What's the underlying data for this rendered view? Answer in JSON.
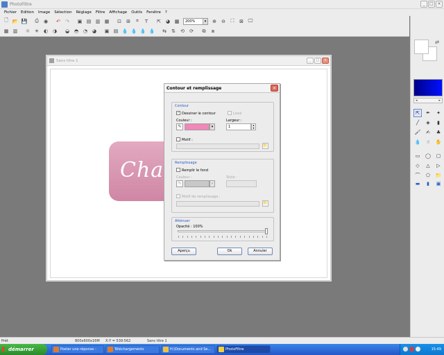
{
  "app": {
    "title": "PhotoFiltre"
  },
  "menu": [
    "Fichier",
    "Edition",
    "Image",
    "Sélection",
    "Réglage",
    "Filtre",
    "Affichage",
    "Outils",
    "Fenêtre",
    "?"
  ],
  "toolbar": {
    "zoom_value": "200%"
  },
  "document": {
    "title": "Sans titre 1",
    "canvas_text": "Charle"
  },
  "dialog": {
    "title": "Contour et remplissage",
    "contour": {
      "group_title": "Contour",
      "draw_contour_label": "Dessiner le contour",
      "draw_contour_checked": true,
      "smooth_label": "Lissé",
      "color_label": "Couleur :",
      "color_value": "#f088b8",
      "width_label": "Largeur :",
      "width_value": "1",
      "motif_label": "Motif :"
    },
    "fill": {
      "group_title": "Remplissage",
      "fill_label": "Remplir le fond",
      "color_label": "Couleur :",
      "style_label": "Style :",
      "fill_motif_label": "Motif de remplissage :"
    },
    "attenuate": {
      "group_title": "Atténuer",
      "opacity_label": "Opacité : 100%",
      "opacity_value": 1.0
    },
    "buttons": {
      "preview": "Aperçu",
      "ok": "Ok",
      "cancel": "Annuler"
    }
  },
  "statusbar": {
    "ready": "Prêt",
    "size": "800x600x16M",
    "coords": "X:Y = 539:562",
    "doc": "Sans titre 1"
  },
  "taskbar": {
    "start": "démarrer",
    "tasks": [
      {
        "label": "Poster une réponse -",
        "icon_color": "#e07a30"
      },
      {
        "label": "Téléchargements",
        "icon_color": "#e07a30"
      },
      {
        "label": "H:\\Documents and Se...",
        "icon_color": "#f0c040"
      },
      {
        "label": "PhotoFiltre",
        "icon_color": "#f0d040"
      }
    ],
    "clock": "15:49"
  },
  "colors": {
    "foreground": "#ffffff",
    "background": "#ffffff",
    "gradient_start": "#000088",
    "gradient_end": "#0010ff"
  }
}
